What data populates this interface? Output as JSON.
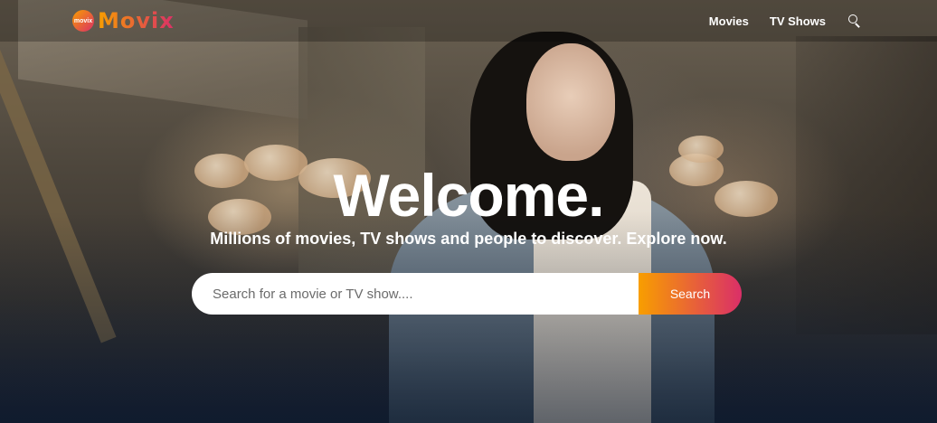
{
  "header": {
    "logo_text": "Movix",
    "logo_badge": "movix",
    "nav": [
      {
        "label": "Movies"
      },
      {
        "label": "TV Shows"
      }
    ],
    "search_icon": "search-icon"
  },
  "hero": {
    "title": "Welcome.",
    "subtitle": "Millions of movies, TV shows and people to discover. Explore now.",
    "search": {
      "placeholder": "Search for a movie or TV show....",
      "value": "",
      "button_label": "Search"
    }
  },
  "colors": {
    "accent_start": "#f89e00",
    "accent_end": "#da2f68",
    "background": "#04152d"
  }
}
